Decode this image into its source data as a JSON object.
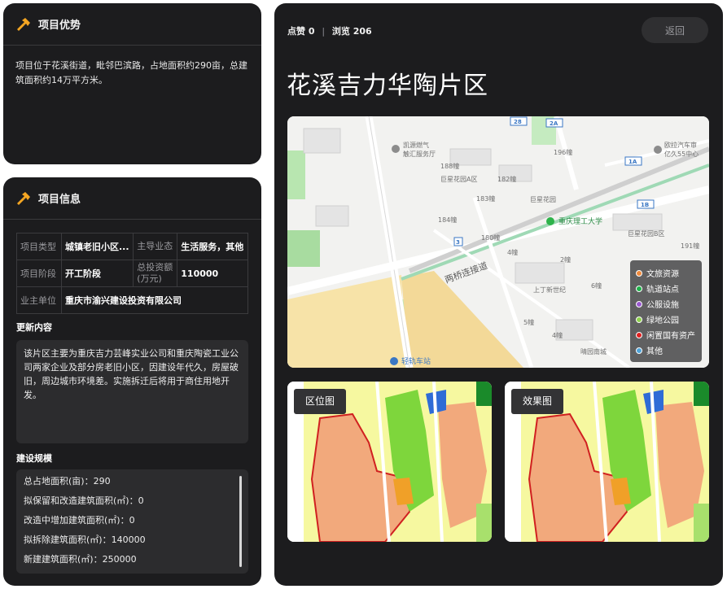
{
  "advantage": {
    "title": "项目优势",
    "text": "项目位于花溪街道，毗邻巴滨路，占地面积约290亩，总建筑面积约14万平方米。"
  },
  "info": {
    "title": "项目信息",
    "table": {
      "type_label": "项目类型",
      "type_value": "城镇老旧小区...",
      "business_label": "主导业态",
      "business_value": "生活服务，其他",
      "stage_label": "项目阶段",
      "stage_value": "开工阶段",
      "invest_label": "总投资额(万元)",
      "invest_value": "110000",
      "owner_label": "业主单位",
      "owner_value": "重庆市渝兴建设投资有限公司"
    },
    "update_label": "更新内容",
    "update_text": "该片区主要为重庆吉力芸峰实业公司和重庆陶瓷工业公司两家企业及部分房老旧小区，因建设年代久，房屋破旧，周边城市环境差。实施拆迁后将用于商住用地开发。",
    "scale_label": "建设规模",
    "scale_rows": [
      "总占地面积(亩)：290",
      "拟保留和改造建筑面积(㎡)：0",
      "改造中增加建筑面积(㎡)：0",
      "拟拆除建筑面积(㎡)：140000",
      "新建建筑面积(㎡)：250000"
    ]
  },
  "main": {
    "likes_label": "点赞",
    "likes_count": "0",
    "separator": "|",
    "views_label": "浏览",
    "views_count": "206",
    "back_label": "返回",
    "project_title": "花溪吉力华陶片区",
    "legend": [
      {
        "label": "文旅资源",
        "color": "#f08a3c"
      },
      {
        "label": "轨道站点",
        "color": "#1fb24a"
      },
      {
        "label": "公服设施",
        "color": "#9b59d0"
      },
      {
        "label": "绿地公园",
        "color": "#8fd14f"
      },
      {
        "label": "闲置国有资产",
        "color": "#e02020"
      },
      {
        "label": "其他",
        "color": "#4fa3d8"
      }
    ],
    "map_labels": {
      "gas": "凯源燃气",
      "gas2": "触汇服务厅",
      "juxing": "巨星花园A区",
      "juxing2": "巨星花园",
      "juxing3": "巨星花园B区",
      "university": "重庆理工大学",
      "road": "两桥连接道",
      "shangding": "上丁新世纪",
      "dingshan": "晴园南城",
      "station": "轻轨车站",
      "auto": "欧拉汽车审",
      "auto2": "亿久55中心",
      "b188": "188幢",
      "b182": "182幢",
      "b183": "183幢",
      "b184": "184幢",
      "b180": "180幢",
      "b196": "196幢",
      "b191": "191幢",
      "b4": "4幢",
      "b5": "5幢",
      "b6": "6幢",
      "b2": "2幢",
      "b4b": "4幢",
      "r28": "28",
      "r2a": "2A",
      "r1a": "1A",
      "r1b": "1B",
      "r3": "3"
    },
    "thumb_loc_label": "区位图",
    "thumb_effect_label": "效果图"
  }
}
